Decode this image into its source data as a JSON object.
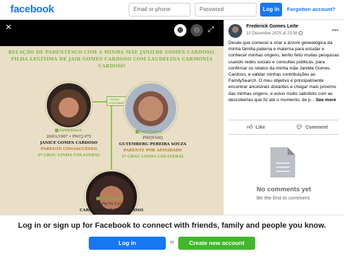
{
  "brand": {
    "logo": "facebook",
    "accent": "#1877f2",
    "green": "#42b72a"
  },
  "topbar": {
    "email_placeholder": "Email or phone",
    "password_placeholder": "Password",
    "login_label": "Log in",
    "forgot_label": "Forgotten account?"
  },
  "viewer": {
    "close_icon": "×",
    "zoom_in_icon": "⊕",
    "zoom_out_icon": "⊖",
    "expand_icon": "⤢"
  },
  "photo": {
    "title": "RELAÇÃO DE PARENTESCO COM A MINHA MÃE JANILDE GOMES CARDOSO, FILHA LEGÍTIMA DE JAIR GOMES CARDOSO COM LAUDELINA CARMONIA CARDOSO",
    "badge": "1 FILHO",
    "badge2": "CONCEBIDO",
    "familysearch": "FamilySearch",
    "person1": {
      "date": "28/01/1967 • PWCJ-975",
      "name": "JANICE GOMES CARDOSO",
      "relation": "PARENTE CONSAGUÍNEO",
      "degree": "2º GRAU LINHA COLATERAL"
    },
    "person2": {
      "date": "PWQY-V6Q",
      "name": "GUTEMBERG PEREIRA SOUZA",
      "relation": "PARENTE POR AFINIDADE",
      "degree": "2º GRAU LINHA COLATERAL"
    },
    "person3": {
      "date": "PW7N-137",
      "name": "CAROLINE SOUZA CARDOSO"
    }
  },
  "post": {
    "author": "Frederick Gomes Leite",
    "date": "10 December 2025 at 23:58",
    "text": "Desde que comecei a criar a árvore genealógica da minha família paterna e materna para estudar e conhecer minhas origens, tenho feito muitas pesquisas usando redes sociais e consultas públicas, para confirmar os relatos da minha mãe Janilde Gomes Cardoso, e validar minhas contribuições ao FamilySearch. O meu objetivo é principalmente encontrar ancestrais distantes e chegar mais próximo das minhas origens, e estou muito satisfeito com as descobertas que fiz até o momento, de p...",
    "see_more": "See more",
    "like_label": "Like",
    "comment_label": "Comment",
    "no_comments": "No comments yet",
    "be_first": "Be the first to comment."
  },
  "banner": {
    "text": "Log in or sign up for Facebook to connect with friends, family and people you know.",
    "login_label": "Log in",
    "or_label": "or",
    "create_label": "Create new account"
  }
}
